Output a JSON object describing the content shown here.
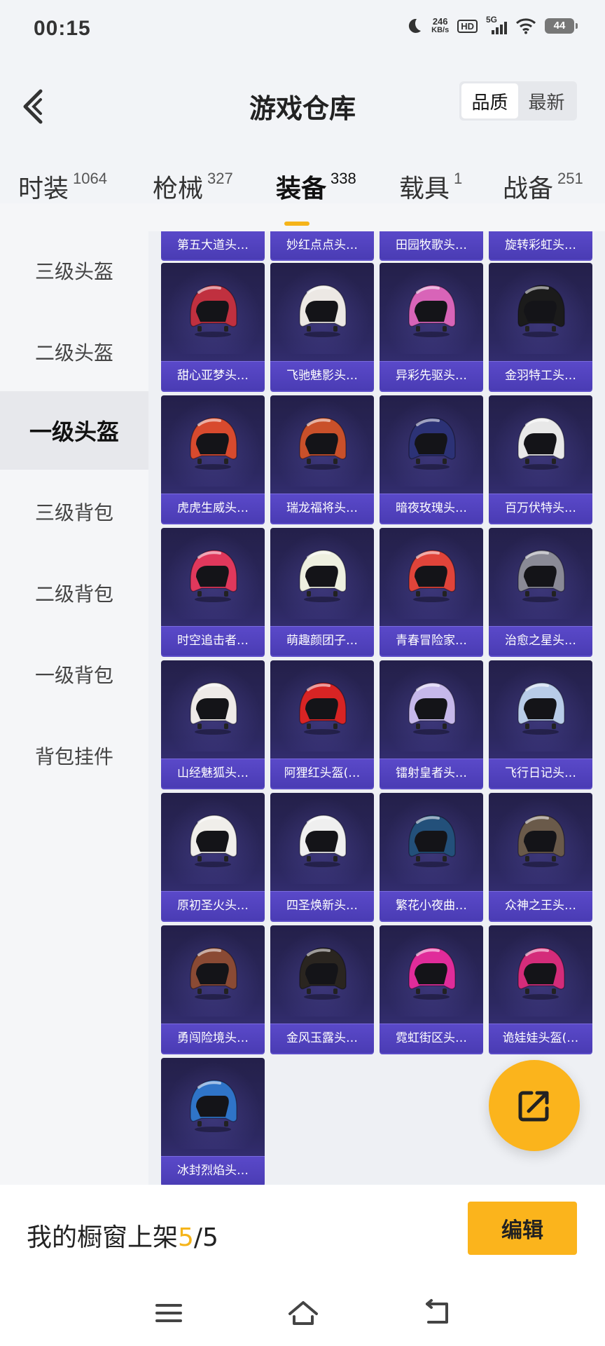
{
  "status_bar": {
    "time": "00:15",
    "net_speed_value": "246",
    "net_speed_unit": "KB/s",
    "hd": "HD",
    "network": "5G",
    "battery": "44"
  },
  "header": {
    "title": "游戏仓库",
    "sort_options": [
      "品质",
      "最新"
    ],
    "active_sort": "品质"
  },
  "categories": [
    {
      "label": "时装",
      "count": "1064"
    },
    {
      "label": "枪械",
      "count": "327"
    },
    {
      "label": "装备",
      "count": "338"
    },
    {
      "label": "载具",
      "count": "1"
    },
    {
      "label": "战备",
      "count": "251"
    }
  ],
  "active_category": "装备",
  "sidebar": {
    "items": [
      "三级头盔",
      "二级头盔",
      "一级头盔",
      "三级背包",
      "二级背包",
      "一级背包",
      "背包挂件"
    ],
    "active": "一级头盔"
  },
  "grid": {
    "partial_row": [
      "第五大道头…",
      "妙红点点头…",
      "田园牧歌头…",
      "旋转彩虹头…"
    ],
    "items": [
      {
        "label": "甜心亚梦头…",
        "color": "#c0303f"
      },
      {
        "label": "飞驰魅影头…",
        "color": "#ece8e4"
      },
      {
        "label": "异彩先驱头…",
        "color": "#d864b8"
      },
      {
        "label": "金羽特工头…",
        "color": "#1b1b1b"
      },
      {
        "label": "虎虎生威头…",
        "color": "#d84a2e"
      },
      {
        "label": "瑞龙福将头…",
        "color": "#c9502a"
      },
      {
        "label": "暗夜玫瑰头…",
        "color": "#2c3276"
      },
      {
        "label": "百万伏特头…",
        "color": "#e8e8e8"
      },
      {
        "label": "时空追击者…",
        "color": "#e0385c"
      },
      {
        "label": "萌趣颜团子…",
        "color": "#eef0e0"
      },
      {
        "label": "青春冒险家…",
        "color": "#e0443a"
      },
      {
        "label": "治愈之星头…",
        "color": "#8a8a96"
      },
      {
        "label": "山经魅狐头…",
        "color": "#eeeae8"
      },
      {
        "label": "阿狸红头盔(…",
        "color": "#d82424"
      },
      {
        "label": "镭射皇者头…",
        "color": "#c6b8ea"
      },
      {
        "label": "飞行日记头…",
        "color": "#b8cce8"
      },
      {
        "label": "原初圣火头…",
        "color": "#f0eeea"
      },
      {
        "label": "四圣焕新头…",
        "color": "#efefef"
      },
      {
        "label": "繁花小夜曲…",
        "color": "#23507a"
      },
      {
        "label": "众神之王头…",
        "color": "#6a5a4a"
      },
      {
        "label": "勇闯险境头…",
        "color": "#8a4a34"
      },
      {
        "label": "金风玉露头…",
        "color": "#2a2520"
      },
      {
        "label": "霓虹街区头…",
        "color": "#e02c9a"
      },
      {
        "label": "诡娃娃头盔(…",
        "color": "#d42c7a"
      },
      {
        "label": "冰封烈焰头…",
        "color": "#2f74c8"
      }
    ]
  },
  "bottom": {
    "showcase_label": "我的橱窗上架",
    "showcase_current": "5",
    "showcase_total": "/5",
    "edit_label": "编辑"
  }
}
